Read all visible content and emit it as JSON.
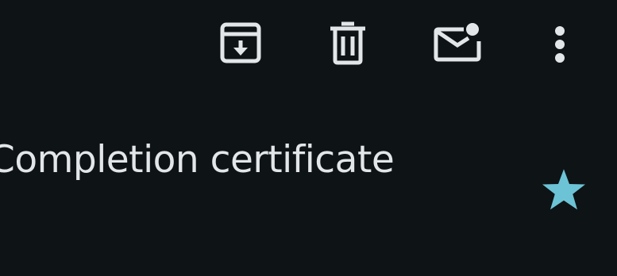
{
  "toolbar": {
    "archive_icon": "archive-icon",
    "delete_icon": "trash-icon",
    "unread_icon": "mark-unread-icon",
    "more_icon": "more-vert-icon",
    "icon_color": "#e3e6e8"
  },
  "message": {
    "subject": "Completion certificate",
    "starred": true,
    "star_color": "#6cc3d5"
  }
}
